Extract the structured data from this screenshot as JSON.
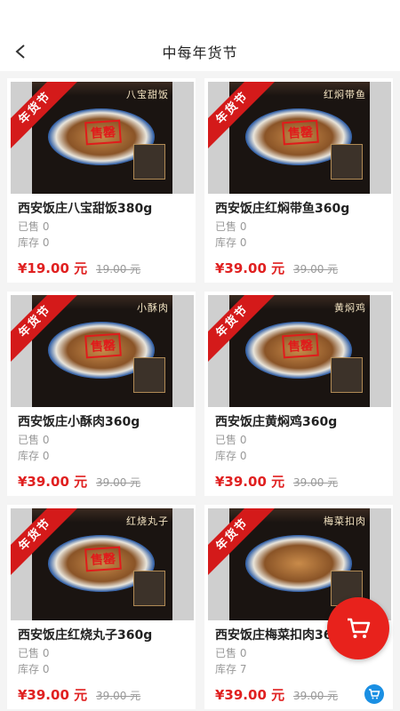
{
  "header": {
    "title": "中每年货节",
    "back_icon": "chevron-left-icon"
  },
  "ribbon_text": "年货节",
  "products": [
    {
      "name": "西安饭庄八宝甜饭380g",
      "dish_label": "八宝甜饭",
      "stamp": "售罄",
      "sold": "已售 0",
      "stock": "库存 0",
      "price": "¥19.00 元",
      "original_price": "19.00 元"
    },
    {
      "name": "西安饭庄红焖带鱼360g",
      "dish_label": "红焖带鱼",
      "stamp": "售罄",
      "sold": "已售 0",
      "stock": "库存 0",
      "price": "¥39.00 元",
      "original_price": "39.00 元"
    },
    {
      "name": "西安饭庄小酥肉360g",
      "dish_label": "小酥肉",
      "stamp": "售罄",
      "sold": "已售 0",
      "stock": "库存 0",
      "price": "¥39.00 元",
      "original_price": "39.00 元"
    },
    {
      "name": "西安饭庄黄焖鸡360g",
      "dish_label": "黄焖鸡",
      "stamp": "售罄",
      "sold": "已售 0",
      "stock": "库存 0",
      "price": "¥39.00 元",
      "original_price": "39.00 元"
    },
    {
      "name": "西安饭庄红烧丸子360g",
      "dish_label": "红烧丸子",
      "stamp": "售罄",
      "sold": "已售 0",
      "stock": "库存 0",
      "price": "¥39.00 元",
      "original_price": "39.00 元"
    },
    {
      "name": "西安饭庄梅菜扣肉360g",
      "dish_label": "梅菜扣肉",
      "stamp": "",
      "sold": "已售 0",
      "stock": "库存 7",
      "price": "¥39.00 元",
      "original_price": "39.00 元"
    }
  ],
  "cart_fab": {
    "icon": "shopping-cart-icon",
    "color": "#e8221c"
  },
  "colors": {
    "price": "#e02020",
    "ribbon": "#d41a1a",
    "add_cart": "#1a8fe3"
  }
}
